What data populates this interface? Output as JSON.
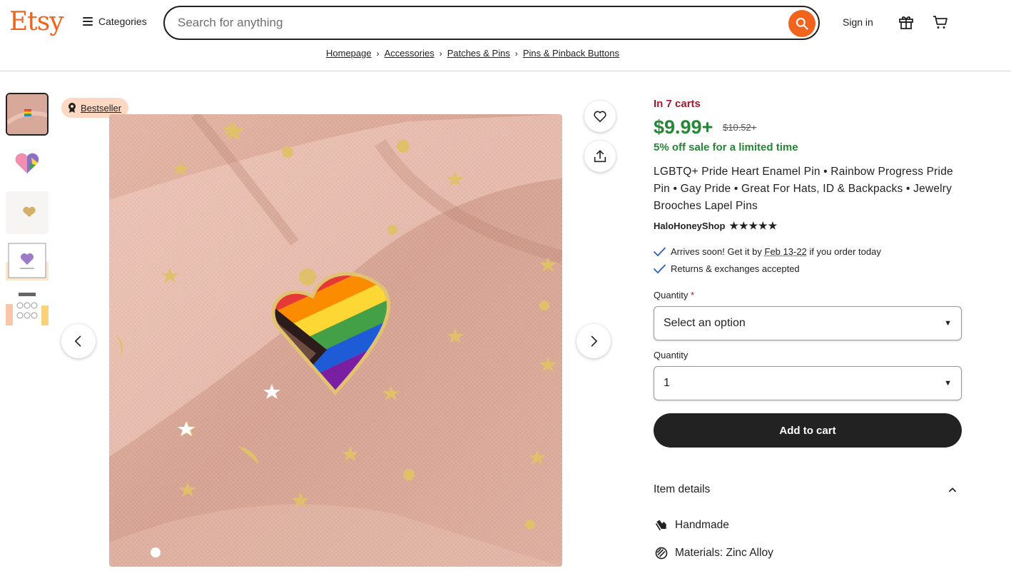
{
  "header": {
    "logo": "Etsy",
    "categories_label": "Categories",
    "search_placeholder": "Search for anything",
    "signin_label": "Sign in"
  },
  "breadcrumb": [
    "Homepage",
    "Accessories",
    "Patches & Pins",
    "Pins & Pinback Buttons"
  ],
  "gallery": {
    "badge": "Bestseller",
    "thumbnail_count": 5,
    "active_thumbnail": 1
  },
  "product": {
    "in_carts": "In 7 carts",
    "price": "$9.99+",
    "original_price": "$10.52+",
    "sale_text": "5% off sale for a limited time",
    "title": "LGBTQ+ Pride Heart Enamel Pin • Rainbow Progress Pride Pin • Gay Pride • Great For Hats, ID & Backpacks • Jewelry Brooches Lapel Pins",
    "shop_name": "HaloHoneyShop",
    "rating_stars": "★★★★★",
    "arrival_prefix": "Arrives soon! Get it by",
    "arrival_dates": "Feb 13-22",
    "arrival_suffix": "if you order today",
    "returns": "Returns & exchanges accepted"
  },
  "options": {
    "quantity_label_1": "Quantity",
    "required_mark": "*",
    "select_1_value": "Select an option",
    "quantity_label_2": "Quantity",
    "select_2_value": "1",
    "add_to_cart": "Add to cart"
  },
  "item_details": {
    "header": "Item details",
    "handmade": "Handmade",
    "materials": "Materials: Zinc Alloy"
  },
  "colors": {
    "brand": "#F1641E",
    "price_green": "#258635",
    "carts_red": "#A61A2E",
    "button_dark": "#222222",
    "badge_bg": "#FDD9C4"
  }
}
